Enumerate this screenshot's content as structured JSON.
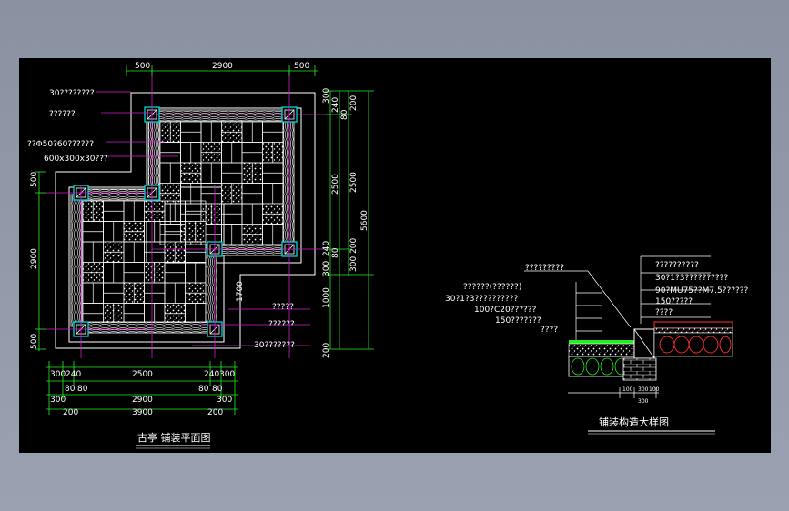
{
  "colors": {
    "background_outer": "#8f97a6",
    "sheet": "#000000",
    "line_white": "#ffffff",
    "dim_green": "#22ee22",
    "leader_magenta": "#d020d0",
    "column_cyan": "#00d8d8",
    "gravel_red": "#ff3030"
  },
  "plan": {
    "title": "古亭 铺装平面图",
    "top_dims": [
      "500",
      "2900",
      "500"
    ],
    "left_dims": [
      "500",
      "2900",
      "500"
    ],
    "right_dims_inner": [
      "300",
      "240",
      "80",
      "2500",
      "240",
      "80",
      "300",
      "200",
      "1000",
      "1700"
    ],
    "right_dims_outer": [
      "200",
      "2500",
      "5600",
      "200",
      "300"
    ],
    "bottom_row1": [
      "300",
      "240",
      "2500",
      "240",
      "300"
    ],
    "bottom_row2": [
      "80",
      "80",
      "80",
      "80"
    ],
    "bottom_row3": [
      "300",
      "2900",
      "300"
    ],
    "bottom_row4": [
      "200",
      "3900",
      "200"
    ],
    "labels_left": [
      "30????????",
      "??????",
      "??Φ50?60??????",
      "600x300x30???"
    ],
    "labels_right": [
      "?????",
      "??????",
      "30???????"
    ]
  },
  "detail": {
    "title": "铺装构造大样图",
    "labels_left": [
      "?????????",
      "??????(??????)",
      "30?1?3??????????",
      "100?C20??????",
      "150???????",
      "????"
    ],
    "labels_right": [
      "??????????",
      "30?1?3??????????",
      "90?MU75??M7.5??????",
      "150?????",
      "????"
    ],
    "bottom_dims": [
      "100",
      "300",
      "100"
    ],
    "total_dim": "300"
  }
}
